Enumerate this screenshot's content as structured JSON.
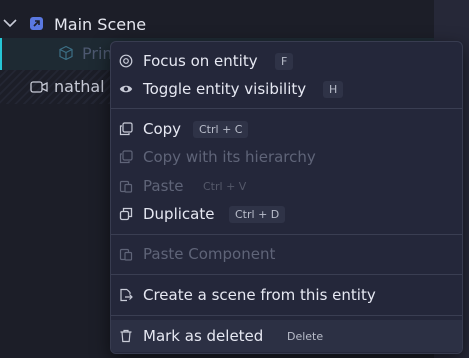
{
  "tree": {
    "scene": {
      "label": "Main Scene",
      "icon": "scene-icon",
      "expand_icon": "chevron-down-icon"
    },
    "items": [
      {
        "label": "Prim",
        "icon": "cube-icon"
      },
      {
        "label": "nathal",
        "icon": "camera-icon"
      }
    ]
  },
  "context_menu": {
    "focus": {
      "label": "Focus on entity",
      "shortcut": "F",
      "icon": "target-icon"
    },
    "toggle": {
      "label": "Toggle entity visibility",
      "shortcut": "H",
      "icon": "eye-icon"
    },
    "copy": {
      "label": "Copy",
      "shortcut": "Ctrl + C",
      "icon": "copy-icon"
    },
    "copy_hier": {
      "label": "Copy with its hierarchy",
      "icon": "copy-icon",
      "disabled": true
    },
    "paste": {
      "label": "Paste",
      "shortcut": "Ctrl + V",
      "icon": "paste-icon",
      "disabled": true
    },
    "duplicate": {
      "label": "Duplicate",
      "shortcut": "Ctrl + D",
      "icon": "duplicate-icon"
    },
    "paste_comp": {
      "label": "Paste Component",
      "icon": "paste-icon",
      "disabled": true
    },
    "create_scene": {
      "label": "Create a scene from this entity",
      "icon": "export-icon"
    },
    "delete": {
      "label": "Mark as deleted",
      "shortcut": "Delete",
      "icon": "trash-icon"
    }
  },
  "colors": {
    "background": "#1c1e28",
    "menu_bg": "#24273a",
    "accent": "#26c6d6",
    "scene_icon": "#5a78e0",
    "disabled_text": "#5f6478"
  }
}
